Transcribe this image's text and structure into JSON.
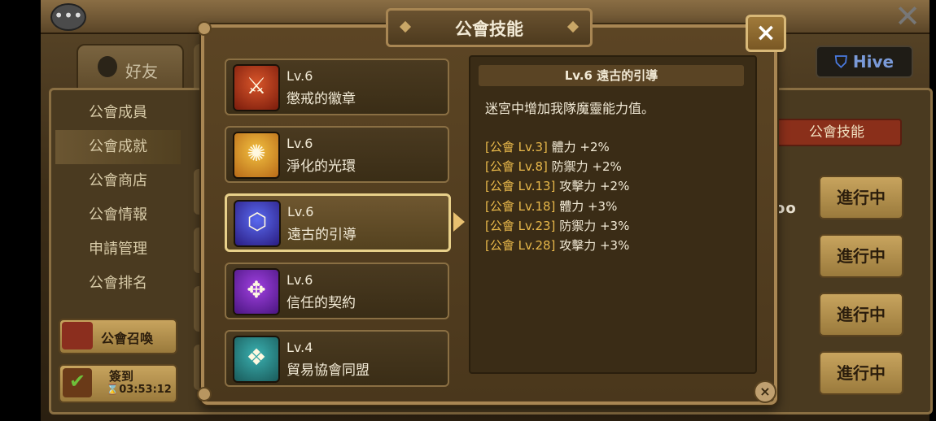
{
  "background": {
    "friend_tab": "好友",
    "hive_button": "Hive",
    "side_menu": [
      {
        "label": "公會成員",
        "active": false
      },
      {
        "label": "公會成就",
        "active": true
      },
      {
        "label": "公會商店",
        "active": false
      },
      {
        "label": "公會情報",
        "active": false
      },
      {
        "label": "申請管理",
        "active": false
      },
      {
        "label": "公會排名",
        "active": false
      }
    ],
    "summon_button": "公會召喚",
    "signin_button": {
      "label": "簽到",
      "timer": "03:53:12"
    },
    "skill_tab": "公會技能",
    "row_dots": "oo",
    "progress_buttons": [
      "進行中",
      "進行中",
      "進行中",
      "進行中"
    ]
  },
  "modal": {
    "title": "公會技能",
    "skills": [
      {
        "level": "Lv.6",
        "name": "懲戒的徽章",
        "icon": "crossed-axes-icon",
        "colors": [
          "#d8552a",
          "#7a1c0c"
        ],
        "selected": false
      },
      {
        "level": "Lv.6",
        "name": "淨化的光環",
        "icon": "radiant-hand-icon",
        "colors": [
          "#f2c040",
          "#b86a18"
        ],
        "selected": false
      },
      {
        "level": "Lv.6",
        "name": "遠古的引導",
        "icon": "ancient-rune-icon",
        "colors": [
          "#5a6af0",
          "#2a1c80"
        ],
        "selected": true
      },
      {
        "level": "Lv.6",
        "name": "信任的契約",
        "icon": "contract-scroll-icon",
        "colors": [
          "#a040e0",
          "#4a1680"
        ],
        "selected": false
      },
      {
        "level": "Lv.4",
        "name": "貿易協會同盟",
        "icon": "trade-crate-icon",
        "colors": [
          "#3ab0b0",
          "#1a5a5a"
        ],
        "selected": false
      }
    ],
    "detail": {
      "header": "Lv.6 遠古的引導",
      "description": "迷宮中增加我隊魔靈能力值。",
      "bonuses": [
        {
          "tag": "[公會 Lv.3]",
          "effect": "體力 +2%"
        },
        {
          "tag": "[公會 Lv.8]",
          "effect": "防禦力 +2%"
        },
        {
          "tag": "[公會 Lv.13]",
          "effect": "攻擊力 +2%"
        },
        {
          "tag": "[公會 Lv.18]",
          "effect": "體力 +3%"
        },
        {
          "tag": "[公會 Lv.23]",
          "effect": "防禦力 +3%"
        },
        {
          "tag": "[公會 Lv.28]",
          "effect": "攻擊力 +3%"
        }
      ]
    },
    "close_glyph": "×"
  }
}
